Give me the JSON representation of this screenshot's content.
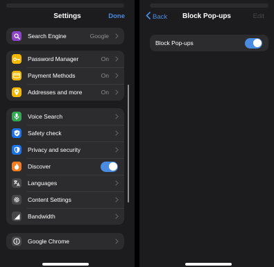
{
  "settings": {
    "title": "Settings",
    "done_label": "Done",
    "groups": [
      {
        "items": [
          {
            "label": "Search Engine",
            "value": "Google",
            "icon": "search-icon",
            "color": "#8e44c9"
          }
        ]
      },
      {
        "items": [
          {
            "label": "Password Manager",
            "value": "On",
            "icon": "key-icon",
            "color": "#f5b800"
          },
          {
            "label": "Payment Methods",
            "value": "On",
            "icon": "card-icon",
            "color": "#f5b800"
          },
          {
            "label": "Addresses and more",
            "value": "On",
            "icon": "location-pin-icon",
            "color": "#f5b800"
          }
        ]
      },
      {
        "items": [
          {
            "label": "Voice Search",
            "icon": "microphone-icon",
            "color": "#34a853"
          },
          {
            "label": "Safety check",
            "icon": "shield-check-icon",
            "color": "#1a73e8"
          },
          {
            "label": "Privacy and security",
            "icon": "shield-icon",
            "color": "#1a73e8"
          },
          {
            "label": "Discover",
            "icon": "flame-icon",
            "color": "#f47c20",
            "toggle": true
          },
          {
            "label": "Languages",
            "icon": "translate-icon",
            "color": "#48484a"
          },
          {
            "label": "Content Settings",
            "icon": "gear-icon",
            "color": "#48484a"
          },
          {
            "label": "Bandwidth",
            "icon": "signal-icon",
            "color": "#48484a"
          }
        ]
      },
      {
        "items": [
          {
            "label": "Google Chrome",
            "icon": "info-icon",
            "color": "#48484a"
          }
        ]
      }
    ]
  },
  "block_popups": {
    "back_label": "Back",
    "title": "Block Pop-ups",
    "edit_label": "Edit",
    "toggle_label": "Block Pop-ups",
    "toggle_on": true
  },
  "colors": {
    "accent": "#4a8ae0",
    "background": "#1c1c1e",
    "cell": "#2c2c2e"
  }
}
